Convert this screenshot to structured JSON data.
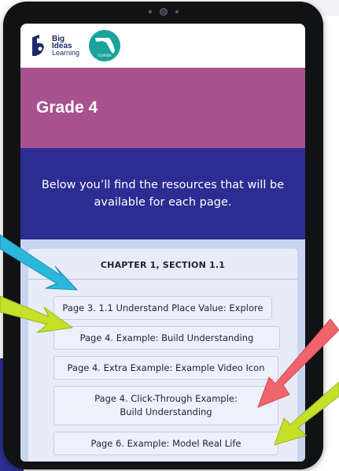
{
  "branding": {
    "bil_line1": "Big",
    "bil_line2": "Ideas",
    "bil_line3": "Learning",
    "seal_text": "FLORIDA"
  },
  "header": {
    "title": "Grade 4"
  },
  "intro": {
    "text": "Below you’ll find the resources that will be available for each page."
  },
  "chapter": {
    "heading": "CHAPTER 1, SECTION 1.1",
    "resources": [
      "Page 3. 1.1 Understand Place Value:  Explore",
      "Page 4. Example:  Build Understanding",
      "Page 4. Extra Example:  Example Video Icon",
      "Page 4. Click-Through Example:  Build Understanding",
      "Page 6. Example:  Model Real Life"
    ]
  },
  "colors": {
    "grade_band": "#a8518f",
    "intro_band": "#2d2c93",
    "content_bg": "#c9d4ef",
    "arrow_cyan": "#2ab9dc",
    "arrow_lime": "#c6e02a",
    "arrow_red": "#f0646c"
  }
}
